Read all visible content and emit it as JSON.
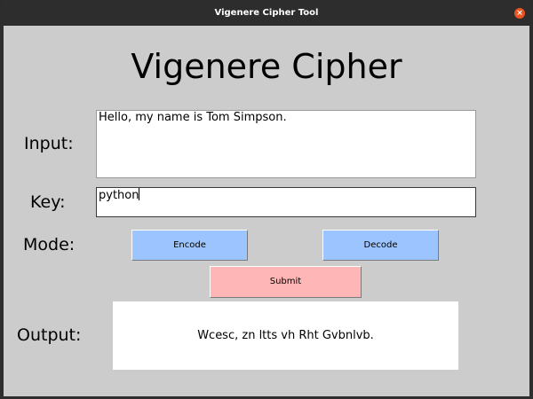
{
  "window": {
    "title": "Vigenere Cipher Tool",
    "close_glyph": "×"
  },
  "app": {
    "heading": "Vigenere Cipher"
  },
  "form": {
    "input_label": "Input:",
    "input_value": "Hello, my name is Tom Simpson.",
    "key_label": "Key:",
    "key_value": "python",
    "mode_label": "Mode:",
    "encode_label": "Encode",
    "decode_label": "Decode",
    "submit_label": "Submit",
    "output_label": "Output:",
    "output_value": "Wcesc, zn ltts vh Rht Gvbnlvb."
  },
  "colors": {
    "titlebar": "#2d2d2d",
    "client_bg": "#cccccc",
    "mode_button": "#9cc4ff",
    "submit_button": "#ffb6b6",
    "close_button": "#e95420"
  }
}
